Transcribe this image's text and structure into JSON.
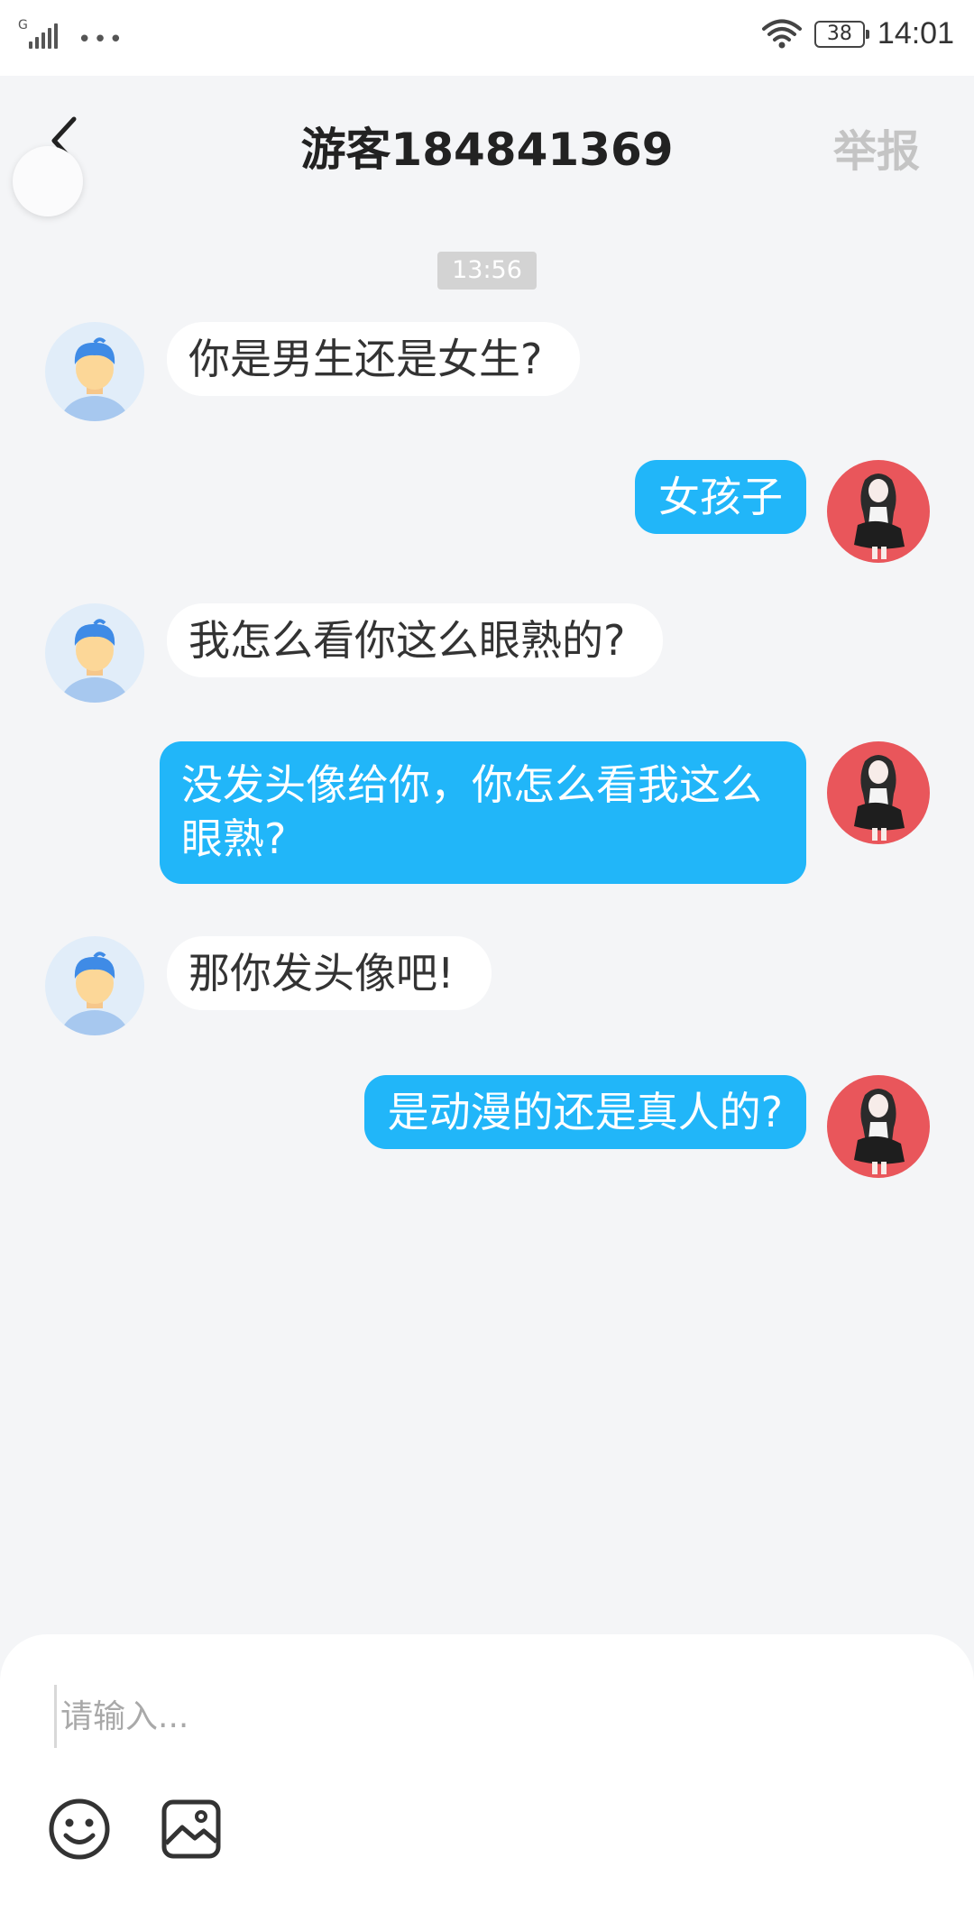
{
  "status_bar": {
    "network_label": "G",
    "dots": "•••",
    "battery": "38",
    "time": "14:01"
  },
  "header": {
    "title": "游客184841369",
    "report_label": "举报"
  },
  "messages": {
    "timestamp": "13:56",
    "items": [
      {
        "side": "left",
        "text": "你是男生还是女生?"
      },
      {
        "side": "right",
        "text": "女孩子"
      },
      {
        "side": "left",
        "text": "我怎么看你这么眼熟的?"
      },
      {
        "side": "right",
        "text": "没发头像给你，你怎么看我这么眼熟?"
      },
      {
        "side": "left",
        "text": "那你发头像吧!"
      },
      {
        "side": "right",
        "text": "是动漫的还是真人的?"
      }
    ]
  },
  "input": {
    "placeholder": "请输入..."
  },
  "icons": {
    "back": "chevron-left-icon",
    "emoji": "emoji-icon",
    "image": "image-icon",
    "wifi": "wifi-icon"
  },
  "colors": {
    "outgoing_bubble": "#21b6f9",
    "incoming_bubble": "#ffffff",
    "background": "#f4f5f7",
    "report_text": "#c4c4c4",
    "own_avatar_bg": "#e9565b"
  }
}
